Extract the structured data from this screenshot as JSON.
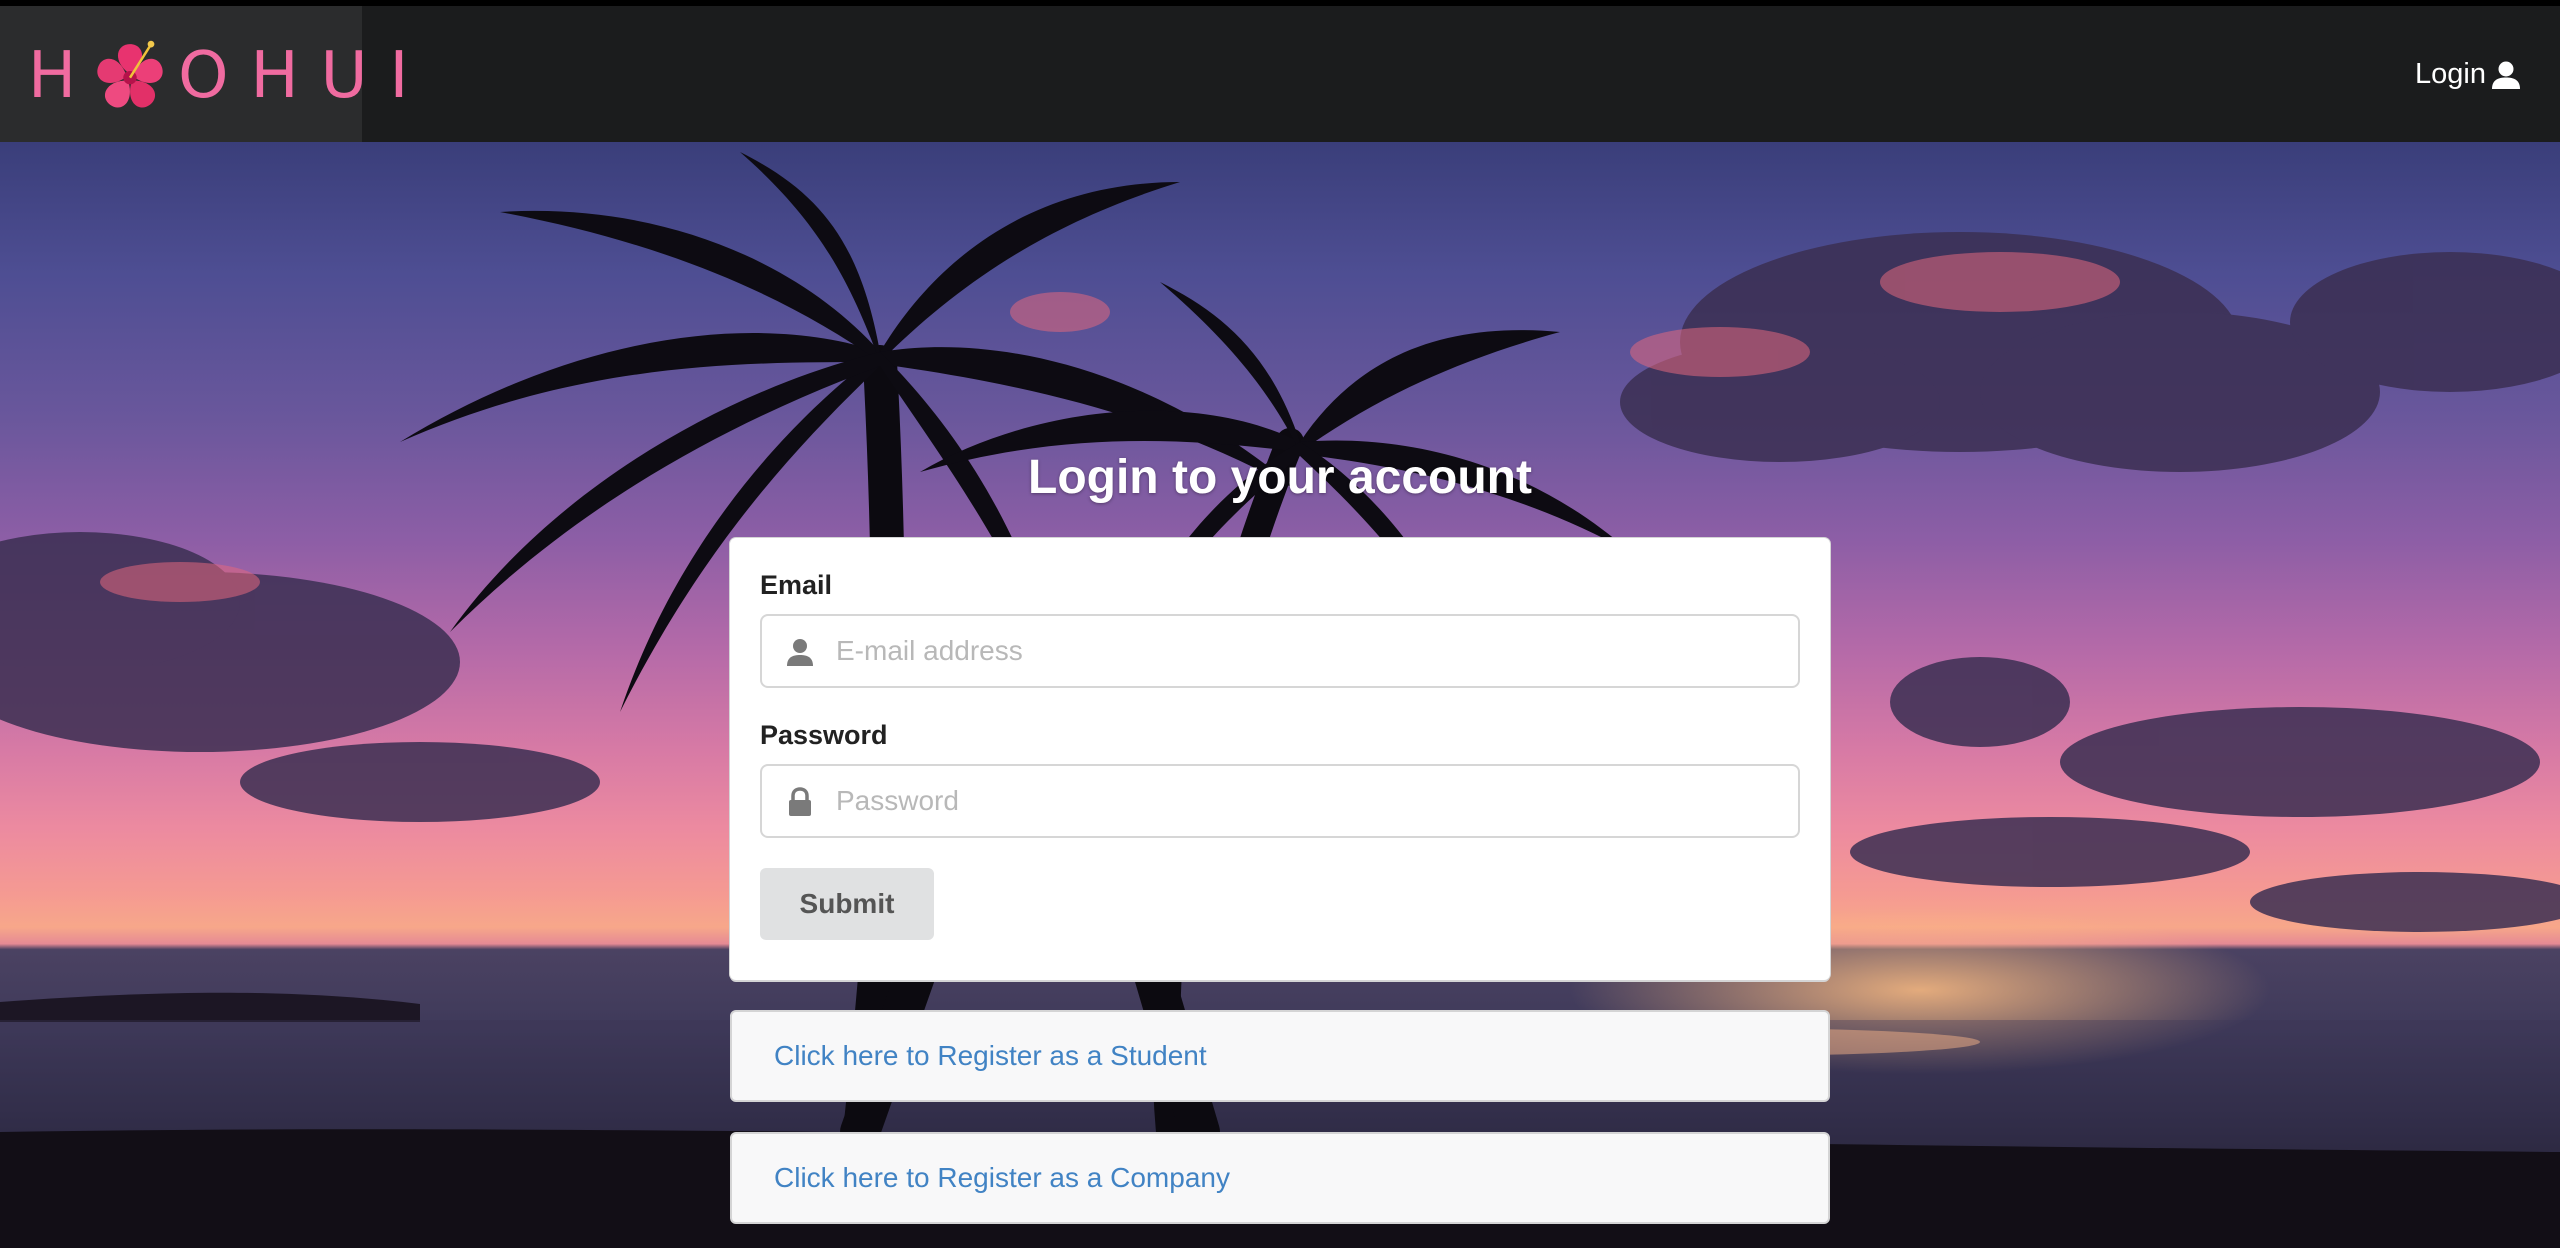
{
  "navbar": {
    "logo_text_first": "H",
    "logo_text_rest": "OHUI",
    "login_label": "Login"
  },
  "login": {
    "title": "Login to your account",
    "email_label": "Email",
    "email_placeholder": "E-mail address",
    "password_label": "Password",
    "password_placeholder": "Password",
    "submit_label": "Submit"
  },
  "register": {
    "student_link": "Click here to Register as a Student",
    "company_link": "Click here to Register as a Company"
  },
  "colors": {
    "navbar_bg": "#1b1c1d",
    "logo_pink": "#f06ba0",
    "link_blue": "#4183c4",
    "button_grey": "#e0e1e2"
  }
}
